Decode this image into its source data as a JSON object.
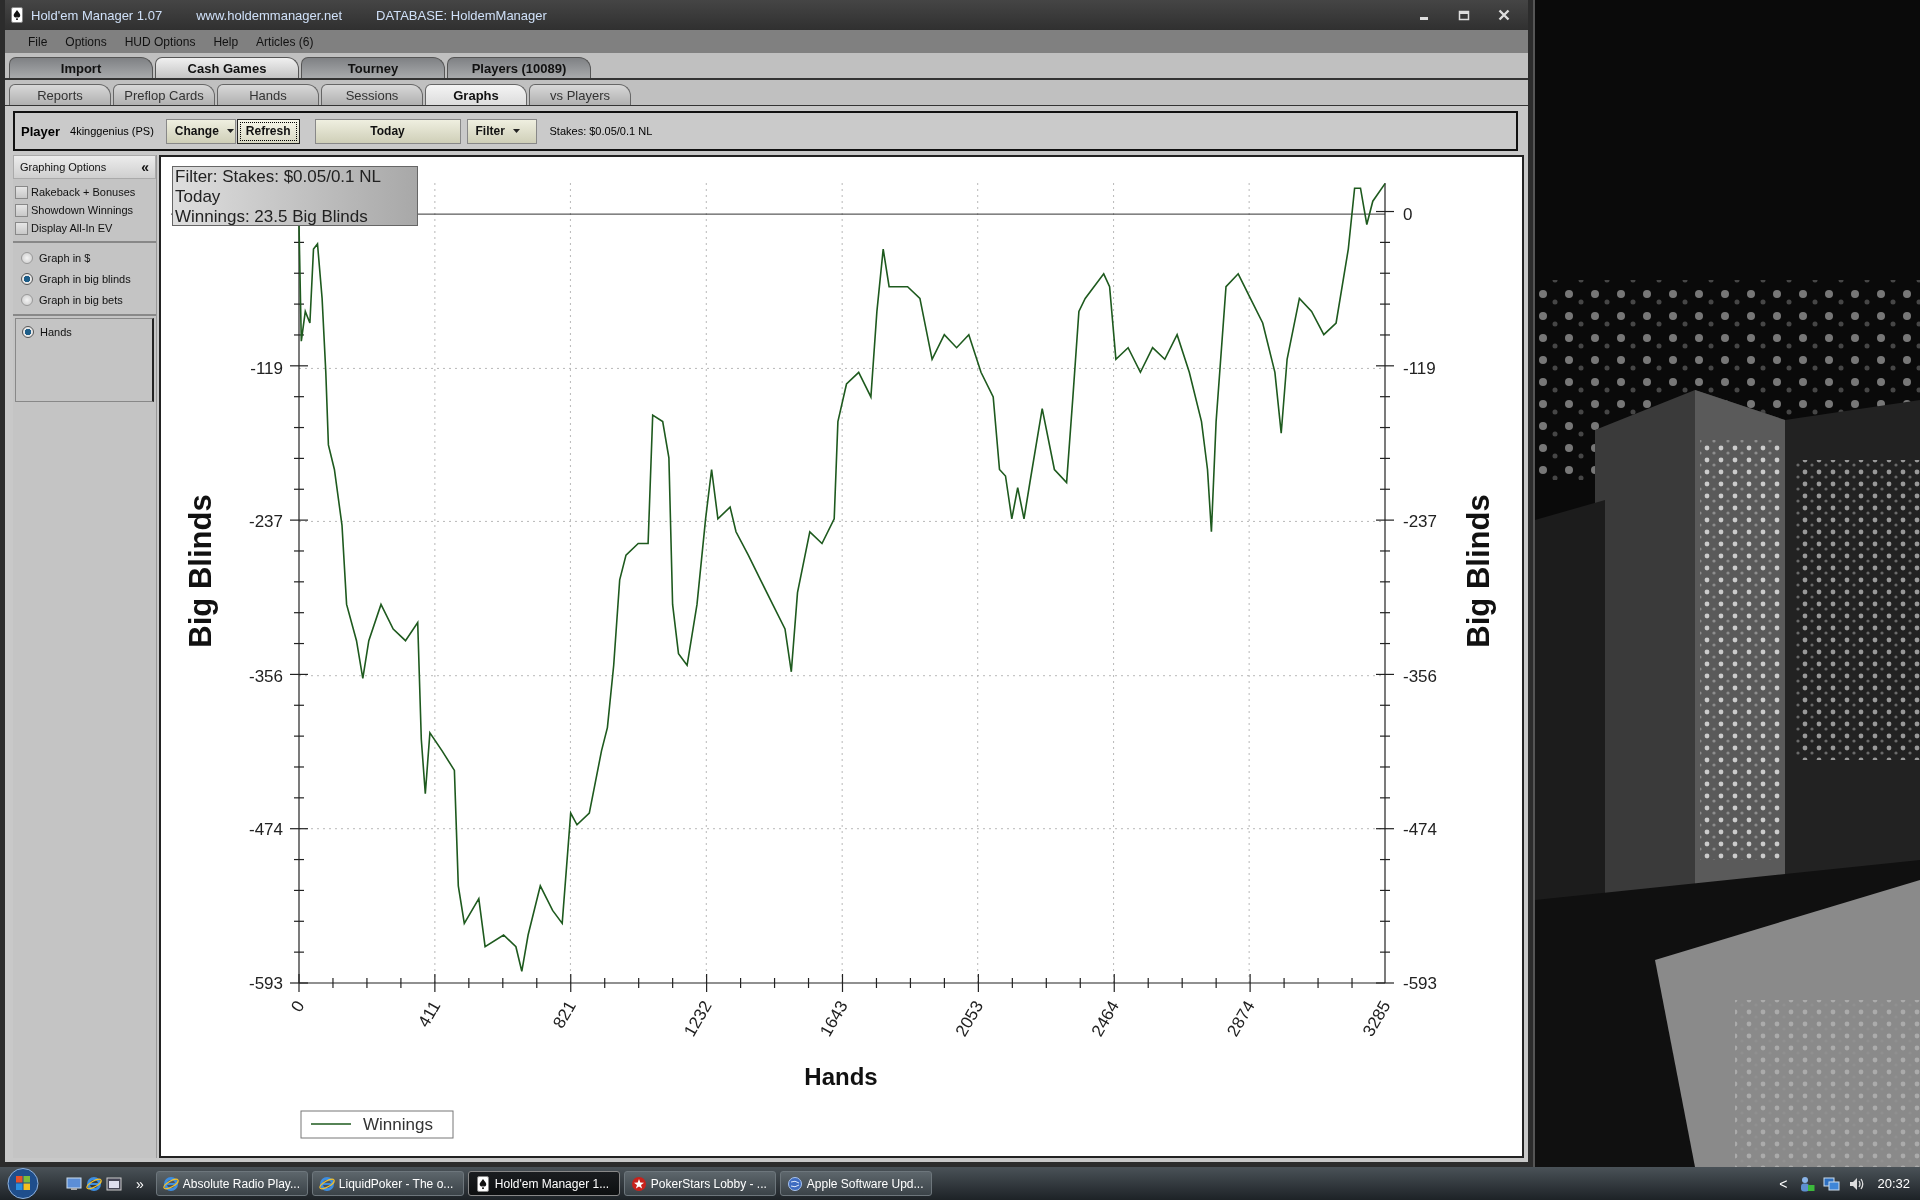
{
  "window": {
    "title": "Hold'em Manager 1.07",
    "website": "www.holdemmanager.net",
    "database": "DATABASE: HoldemManager"
  },
  "menu": [
    "File",
    "Options",
    "HUD Options",
    "Help",
    "Articles (6)"
  ],
  "main_tabs": [
    {
      "label": "Import",
      "selected": false
    },
    {
      "label": "Cash Games",
      "selected": true
    },
    {
      "label": "Tourney",
      "selected": false
    },
    {
      "label": "Players (10089)",
      "selected": false
    }
  ],
  "sub_tabs": [
    {
      "label": "Reports",
      "selected": false
    },
    {
      "label": "Preflop Cards",
      "selected": false
    },
    {
      "label": "Hands",
      "selected": false
    },
    {
      "label": "Sessions",
      "selected": false
    },
    {
      "label": "Graphs",
      "selected": true
    },
    {
      "label": "vs Players",
      "selected": false
    }
  ],
  "toolbar": {
    "player_label": "Player",
    "player": "4kinggenius (PS)",
    "buttons": [
      {
        "label": "Change",
        "kind": "dropdown",
        "focused": false
      },
      {
        "label": "Refresh",
        "kind": "plain",
        "focused": true
      },
      {
        "label": "Today",
        "kind": "wide",
        "focused": false
      },
      {
        "label": "Filter",
        "kind": "dropdown",
        "focused": false
      }
    ],
    "stakes": "Stakes: $0.05/0.1 NL"
  },
  "graphing_options": {
    "title": "Graphing Options",
    "collapse": "«",
    "checkboxes": [
      {
        "label": "Rakeback + Bonuses",
        "checked": false
      },
      {
        "label": "Showdown Winnings",
        "checked": false
      },
      {
        "label": "Display All-In EV",
        "checked": false
      }
    ],
    "units": [
      {
        "label": "Graph in $",
        "selected": false
      },
      {
        "label": "Graph in big blinds",
        "selected": true
      },
      {
        "label": "Graph in big bets",
        "selected": false
      }
    ],
    "axis": [
      {
        "label": "Hands",
        "selected": true
      }
    ]
  },
  "chart": {
    "info": [
      "Filter: Stakes: $0.05/0.1 NL",
      "Today",
      "Winnings: 23.5 Big Blinds"
    ],
    "left_axis_labels": [
      "-119",
      "-237",
      "-356",
      "-474",
      "-593"
    ],
    "chart_data": {
      "type": "line",
      "xlabel": "Hands",
      "ylabel": "Big Blinds",
      "x": [
        0,
        7,
        19,
        33,
        44,
        56,
        70,
        81,
        89,
        107,
        130,
        144,
        174,
        193,
        211,
        248,
        285,
        322,
        359,
        370,
        382,
        396,
        433,
        470,
        482,
        500,
        544,
        563,
        619,
        656,
        674,
        693,
        730,
        767,
        796,
        822,
        841,
        878,
        915,
        933,
        952,
        970,
        989,
        1026,
        1056,
        1070,
        1100,
        1119,
        1130,
        1148,
        1174,
        1204,
        1230,
        1248,
        1267,
        1304,
        1322,
        1359,
        1396,
        1433,
        1470,
        1489,
        1508,
        1545,
        1582,
        1619,
        1630,
        1656,
        1693,
        1730,
        1748,
        1767,
        1785,
        1841,
        1878,
        1915,
        1952,
        1989,
        2026,
        2063,
        2100,
        2119,
        2137,
        2156,
        2174,
        2193,
        2211,
        2248,
        2285,
        2322,
        2341,
        2359,
        2378,
        2434,
        2452,
        2471,
        2508,
        2545,
        2582,
        2619,
        2656,
        2693,
        2730,
        2748,
        2760,
        2774,
        2804,
        2841,
        2878,
        2915,
        2952,
        2971,
        2989,
        3026,
        3063,
        3100,
        3137,
        3174,
        3193,
        3211,
        3230,
        3248,
        3285
      ],
      "series": [
        {
          "name": "Winnings",
          "color": "#1e5a1e",
          "values": [
            -8,
            -98,
            -75,
            -84,
            -27,
            -23,
            -65,
            -122,
            -178,
            -197,
            -240,
            -301,
            -329,
            -358,
            -329,
            -301,
            -320,
            -329,
            -315,
            -405,
            -447,
            -400,
            -414,
            -429,
            -518,
            -547,
            -528,
            -565,
            -556,
            -565,
            -584,
            -556,
            -518,
            -537,
            -547,
            -462,
            -471,
            -462,
            -414,
            -396,
            -348,
            -282,
            -263,
            -254,
            -254,
            -155,
            -160,
            -188,
            -301,
            -339,
            -348,
            -301,
            -235,
            -197,
            -235,
            -226,
            -245,
            -263,
            -282,
            -301,
            -320,
            -353,
            -292,
            -245,
            -254,
            -235,
            -160,
            -131,
            -122,
            -141,
            -75,
            -27,
            -56,
            -56,
            -65,
            -112,
            -93,
            -103,
            -93,
            -122,
            -141,
            -197,
            -202,
            -235,
            -211,
            -235,
            -207,
            -150,
            -197,
            -207,
            -141,
            -75,
            -65,
            -46,
            -56,
            -112,
            -103,
            -122,
            -103,
            -112,
            -93,
            -122,
            -160,
            -197,
            -245,
            -160,
            -56,
            -46,
            -65,
            -84,
            -122,
            -169,
            -112,
            -65,
            -75,
            -93,
            -84,
            -27,
            20,
            20,
            -8,
            10,
            23.5
          ]
        }
      ],
      "xlim": [
        0,
        3285
      ],
      "ylim": [
        -593,
        24
      ],
      "xticks": [
        0,
        411,
        821,
        1232,
        1643,
        2053,
        2464,
        2874,
        3285
      ],
      "yticks": [
        0,
        -119,
        -237,
        -356,
        -474,
        -593
      ],
      "grid": true
    }
  },
  "taskbar": {
    "overflow": "»",
    "tasks": [
      {
        "label": "Absolute Radio Play...",
        "kind": "browser",
        "selected": false
      },
      {
        "label": "LiquidPoker - The o...",
        "kind": "browser",
        "selected": false
      },
      {
        "label": "Hold'em Manager 1...",
        "kind": "cards",
        "selected": true
      },
      {
        "label": "PokerStars Lobby - ...",
        "kind": "poker",
        "selected": false
      },
      {
        "label": "Apple Software Upd...",
        "kind": "updater",
        "selected": false
      }
    ],
    "tray_arrow": "<",
    "clock": "20:32"
  }
}
